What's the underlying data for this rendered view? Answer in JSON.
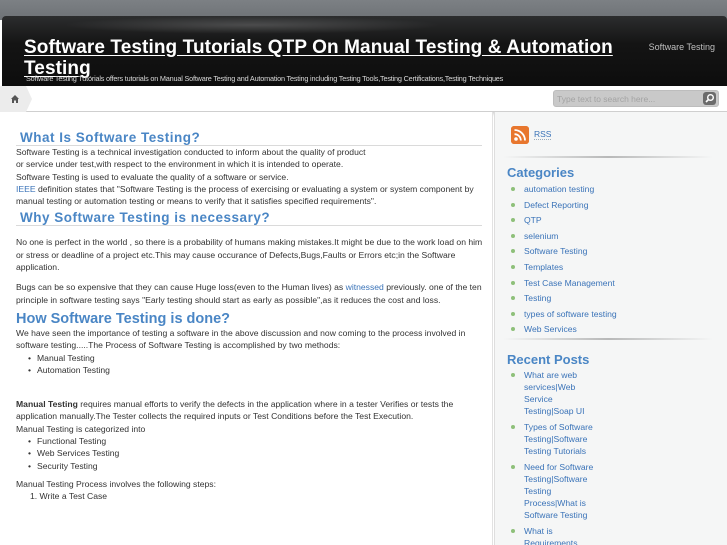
{
  "header": {
    "site_title": "Software Testing Tutorials QTP On Manual Testing & Automation Testing",
    "site_description": "Software Testing Tutorials offers tutorials on Manual Software Testing and Automation Testing including Testing Tools,Testing Certifications,Testing Techniques",
    "top_link": "Software Testing"
  },
  "nav": {
    "home_icon": "home-icon",
    "search_placeholder": "Type text to search here...",
    "search_icon": "magnifier-icon"
  },
  "content": {
    "section1": {
      "heading": "What Is Software Testing?",
      "lines": [
        "Software Testing is a technical investigation conducted to inform about the quality of product",
        "or service under test,with respect to the environment in which it is intended to operate.",
        "Software Testing is used to evaluate the quality of a software or service."
      ],
      "ieee_link": "IEEE",
      "ieee_text": " definition states that \"Software Testing is the process of exercising or evaluating a system or system component by manual testing or automation testing or means to verify that it satisfies specified requirements\"."
    },
    "section2": {
      "heading": "Why Software Testing is necessary?",
      "para1": "No one is perfect in the world , so there is a probability of humans making mistakes.It might be due to the work load on him or stress or deadline of a project etc.This may cause occurance of Defects,Bugs,Faults or Errors etc;in the Software application.",
      "para2_before": "Bugs can be so expensive that they can cause Huge loss(even to the Human lives) as ",
      "para2_link": "witnessed",
      "para2_after": " previously. one of the ten principle in software testing says \"Early testing should start as early as possible\",as it reduces the cost and loss."
    },
    "section3": {
      "heading": "How Software Testing is done?",
      "intro": "We have seen the importance of testing a software in the above discussion and now coming to the process involved in software testing.....The Process of Software Testing is accomplished by two methods:",
      "methods": [
        "Manual Testing",
        "Automation Testing"
      ],
      "manual_bold": "Manual Testing",
      "manual_text": " requires manual efforts to verify the defects in the application where in a tester Verifies or tests the application manually.The Tester collects the required inputs or Test Conditions before the Test Execution.",
      "categorized": "Manual Testing is categorized into",
      "categories": [
        "Functional Testing",
        "Web Services Testing",
        "Security Testing"
      ],
      "process_intro": "Manual Testing Process involves the following steps:",
      "steps": [
        "1. Write a Test Case"
      ]
    }
  },
  "sidebar": {
    "rss_label": "RSS",
    "categories_title": "Categories",
    "categories": [
      "automation testing",
      "Defect Reporting",
      "QTP",
      "selenium",
      "Software Testing",
      "Templates",
      "Test Case Management",
      "Testing",
      "types of software testing",
      "Web Services"
    ],
    "recent_title": "Recent Posts",
    "recent_posts": [
      "What are web services|Web Service Testing|Soap UI",
      "Types of Software Testing|Software Testing Tutorials",
      "Need for Software Testing|Software Testing Process|What is Software Testing",
      "What is Requirements"
    ]
  },
  "colors": {
    "heading_blue": "#4a86c5",
    "link_blue": "#3a73b8",
    "bullet_green": "#8ec07a",
    "rss_orange": "#e8772e"
  }
}
